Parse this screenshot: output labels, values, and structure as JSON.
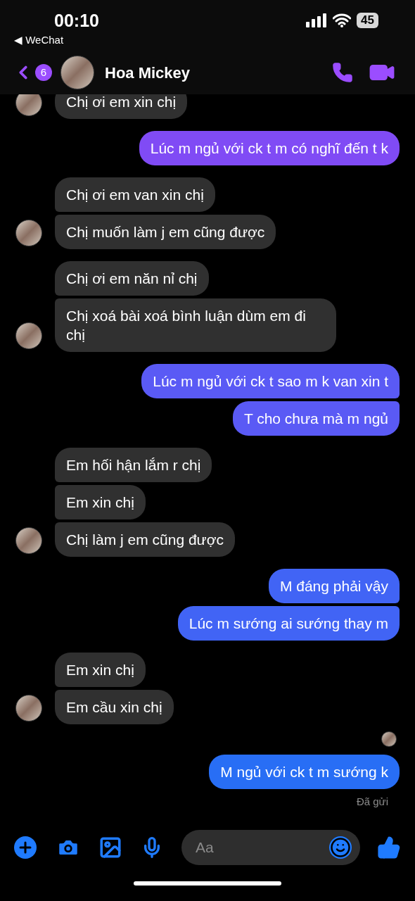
{
  "status_bar": {
    "time": "00:10",
    "back_app": "◀ WeChat",
    "battery": "45"
  },
  "header": {
    "unread_count": "6",
    "contact_name": "Hoa Mickey"
  },
  "groups": [
    {
      "kind": "received",
      "messages": [
        "Chị ơi em xin chị"
      ]
    },
    {
      "kind": "sent",
      "messages": [
        "Lúc m ngủ với ck t m có nghĩ đến t k"
      ]
    },
    {
      "kind": "received",
      "messages": [
        "Chị ơi em van xin chị",
        "Chị muốn làm j em cũng được"
      ]
    },
    {
      "kind": "received",
      "messages": [
        "Chị ơi em năn nỉ chị",
        "Chị xoá bài xoá bình luận dùm em đi chị"
      ]
    },
    {
      "kind": "sent",
      "messages": [
        "Lúc m ngủ với ck t sao m k van xin t",
        "T cho chưa mà m ngủ"
      ]
    },
    {
      "kind": "received",
      "messages": [
        "Em hối hận lắm r chị",
        "Em xin chị",
        "Chị làm j em cũng được"
      ]
    },
    {
      "kind": "sent",
      "messages": [
        "M đáng phải vậy",
        "Lúc m sướng ai sướng thay m"
      ]
    },
    {
      "kind": "received",
      "messages": [
        "Em xin chị",
        "Em cầu xin chị"
      ]
    },
    {
      "kind": "sent",
      "messages": [
        "M ngủ với ck t m sướng k"
      ]
    }
  ],
  "read_receipt": true,
  "delivery_status": "Đã gửi",
  "composer": {
    "placeholder": "Aa"
  }
}
